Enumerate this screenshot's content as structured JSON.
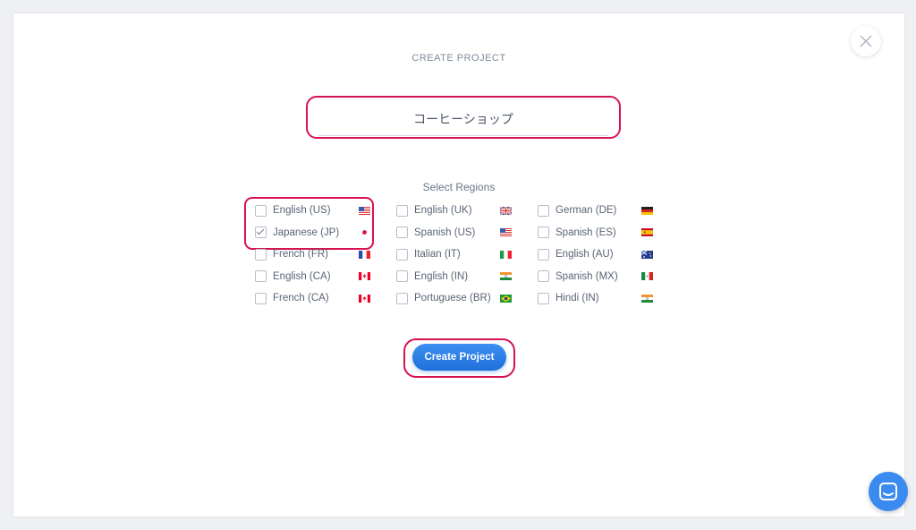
{
  "modal": {
    "title": "CREATE PROJECT",
    "close_icon": "close-icon"
  },
  "project_name": {
    "value": "コーヒーショップ"
  },
  "regions": {
    "label": "Select Regions",
    "items": [
      {
        "label": "English (US)",
        "flag": "us",
        "checked": false
      },
      {
        "label": "English (UK)",
        "flag": "uk",
        "checked": false
      },
      {
        "label": "German (DE)",
        "flag": "de",
        "checked": false
      },
      {
        "label": "Japanese (JP)",
        "flag": "jp",
        "checked": true
      },
      {
        "label": "Spanish (US)",
        "flag": "us",
        "checked": false
      },
      {
        "label": "Spanish (ES)",
        "flag": "es",
        "checked": false
      },
      {
        "label": "French (FR)",
        "flag": "fr",
        "checked": false
      },
      {
        "label": "Italian (IT)",
        "flag": "it",
        "checked": false
      },
      {
        "label": "English (AU)",
        "flag": "au",
        "checked": false
      },
      {
        "label": "English (CA)",
        "flag": "ca",
        "checked": false
      },
      {
        "label": "English (IN)",
        "flag": "in",
        "checked": false
      },
      {
        "label": "Spanish (MX)",
        "flag": "mx",
        "checked": false
      },
      {
        "label": "French (CA)",
        "flag": "ca",
        "checked": false
      },
      {
        "label": "Portuguese (BR)",
        "flag": "br",
        "checked": false
      },
      {
        "label": "Hindi (IN)",
        "flag": "in",
        "checked": false
      }
    ]
  },
  "actions": {
    "create_label": "Create Project"
  },
  "colors": {
    "accent": "#1f6fd9",
    "highlight": "#d7124e"
  }
}
